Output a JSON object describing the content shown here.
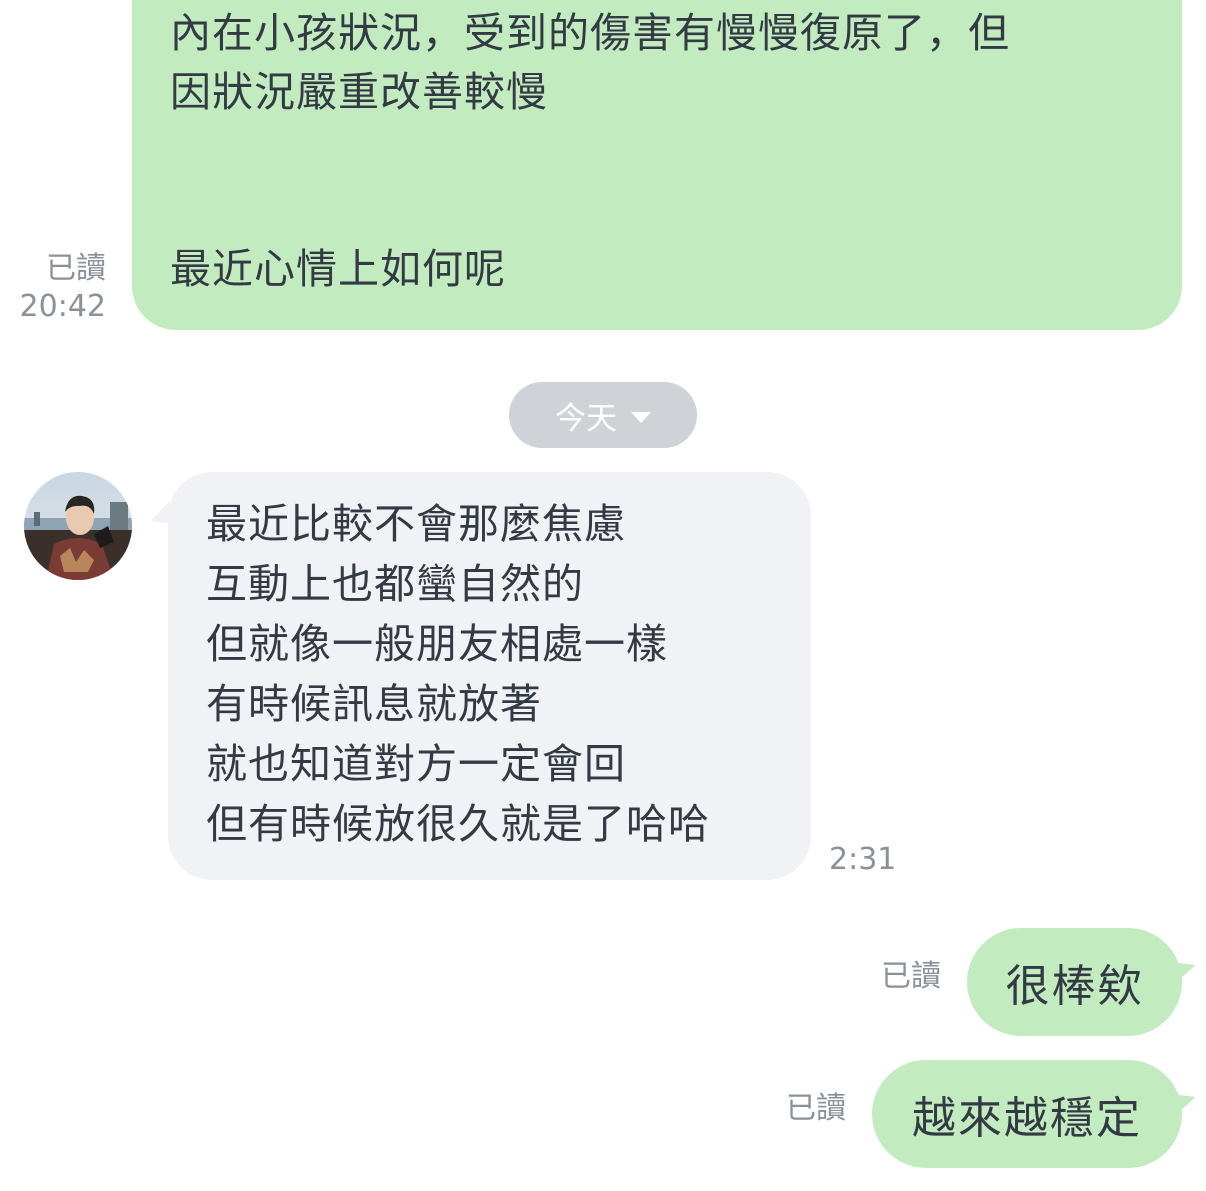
{
  "colors": {
    "outgoing_bubble": "#c3ebc0",
    "incoming_bubble": "#f1f2f5",
    "date_pill": "#cfd2d6",
    "meta_text": "#8a9199",
    "message_text": "#333a44"
  },
  "messages": [
    {
      "direction": "outgoing",
      "text": "內在小孩狀況，受到的傷害有慢慢復原了，但\n因狀況嚴重改善較慢\n\n\n最近心情上如何呢",
      "read_label": "已讀",
      "time": "20:42"
    },
    {
      "direction": "incoming",
      "text": "最近比較不會那麼焦慮\n互動上也都蠻自然的\n但就像一般朋友相處一樣\n有時候訊息就放著\n就也知道對方一定會回\n但有時候放很久就是了哈哈",
      "time": "2:31"
    },
    {
      "direction": "outgoing",
      "text": "很棒欸",
      "read_label": "已讀"
    },
    {
      "direction": "outgoing",
      "text": "越來越穩定",
      "read_label": "已讀"
    }
  ],
  "date_separator": {
    "label": "今天",
    "icon": "chevron-down-icon"
  },
  "avatar": {
    "icon": "user-avatar-photo"
  }
}
